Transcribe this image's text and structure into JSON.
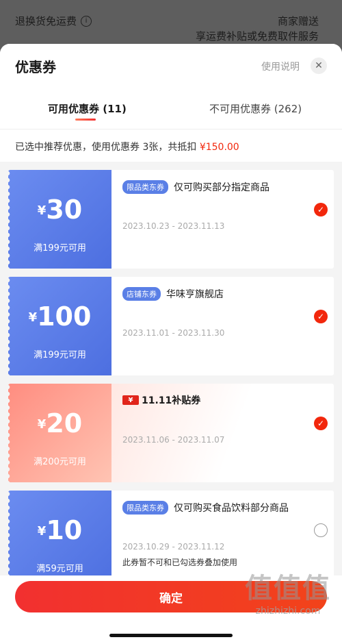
{
  "background": {
    "left_label": "退换货免运费",
    "right_line1": "商家赠送",
    "right_line2": "享运费补贴或免费取件服务"
  },
  "sheet": {
    "title": "优惠券",
    "help_label": "使用说明",
    "close_icon": "close-icon",
    "tabs": [
      {
        "label": "可用优惠券 (11)",
        "active": true
      },
      {
        "label": "不可用优惠券 (262)",
        "active": false
      }
    ],
    "summary_text": "已选中推荐优惠，使用优惠券 3张，共抵扣 ",
    "summary_amount": "¥150.00"
  },
  "coupons": [
    {
      "yen": "¥",
      "value": "30",
      "condition": "满199元可用",
      "badge": "限品类东券",
      "title": "仅可购买部分指定商品",
      "dates": "2023.10.23 - 2023.11.13",
      "note": "",
      "selected": true,
      "style": "blue"
    },
    {
      "yen": "¥",
      "value": "100",
      "condition": "满199元可用",
      "badge": "店铺东券",
      "title": "华味亨旗舰店",
      "dates": "2023.11.01 - 2023.11.30",
      "note": "",
      "selected": true,
      "style": "blue"
    },
    {
      "yen": "¥",
      "value": "20",
      "condition": "满200元可用",
      "badge": "",
      "title": "11.11补贴券",
      "dates": "2023.11.06 - 2023.11.07",
      "note": "",
      "selected": true,
      "style": "pink"
    },
    {
      "yen": "¥",
      "value": "10",
      "condition": "满59元可用",
      "badge": "限品类东券",
      "title": "仅可购买食品饮料部分商品",
      "dates": "2023.10.29 - 2023.11.12",
      "note": "此券暂不可和已勾选券叠加使用",
      "selected": false,
      "style": "blue"
    }
  ],
  "confirm_label": "确定",
  "watermark": {
    "big": "值值值",
    "url": "zhizhizhi.com"
  },
  "colors": {
    "accent": "#f2270c",
    "coupon_blue": "#5a7fe6",
    "coupon_pink": "#ff8d80"
  }
}
